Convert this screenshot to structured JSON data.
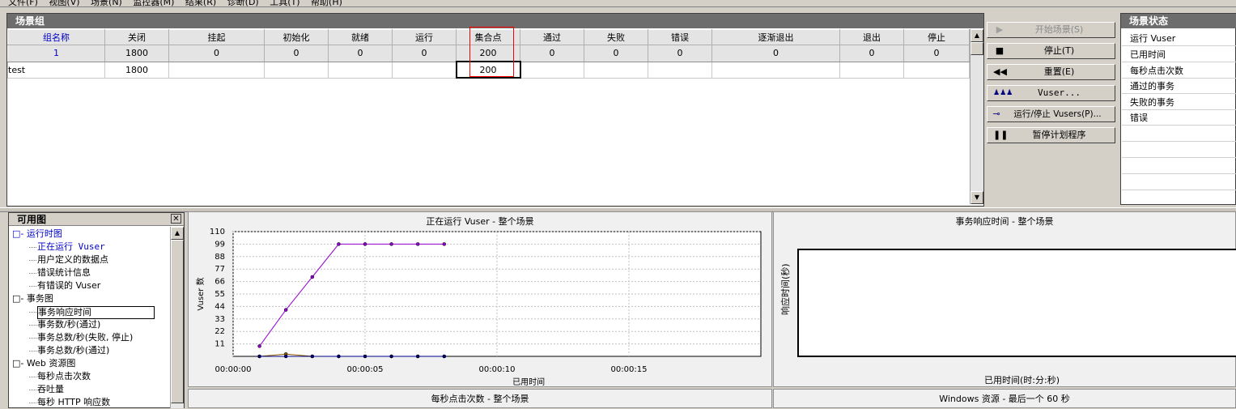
{
  "menu": [
    "文件(F)",
    "视图(V)",
    "场景(N)",
    "监控器(M)",
    "结果(R)",
    "诊断(D)",
    "工具(T)",
    "帮助(H)"
  ],
  "scenario_group": {
    "title": "场景组",
    "columns": [
      "组名称",
      "关闭",
      "挂起",
      "初始化",
      "就绪",
      "运行",
      "集合点",
      "通过",
      "失败",
      "错误",
      "逐渐退出",
      "退出",
      "停止"
    ],
    "totals": [
      "1",
      "1800",
      "0",
      "0",
      "0",
      "0",
      "200",
      "0",
      "0",
      "0",
      "0",
      "0",
      "0"
    ],
    "rows": [
      [
        "test",
        "1800",
        "",
        "",
        "",
        "",
        "200",
        "",
        "",
        "",
        "",
        "",
        ""
      ]
    ]
  },
  "controls": {
    "start": "开始场景(S)",
    "stop": "停止(T)",
    "reset": "重置(E)",
    "vuser": "Vuser...",
    "run_stop_vusers": "运行/停止 Vusers(P)...",
    "pause_schedule": "暂停计划程序"
  },
  "scenario_status": {
    "title": "场景状态",
    "rows": [
      "运行 Vuser",
      "已用时间",
      "每秒点击次数",
      "通过的事务",
      "失败的事务",
      "错误"
    ]
  },
  "available_graphs": {
    "title": "可用图",
    "items": [
      {
        "text": "□- 运行时图",
        "level": 0,
        "color": "#0000cc"
      },
      {
        "text": "正在运行 Vuser",
        "level": 1,
        "color": "#0000cc",
        "mono": true
      },
      {
        "text": "用户定义的数据点",
        "level": 1
      },
      {
        "text": "错误统计信息",
        "level": 1
      },
      {
        "text": "有错误的 Vuser",
        "level": 1
      },
      {
        "text": "□- 事务图",
        "level": 0
      },
      {
        "text": "事务响应时间",
        "level": 1,
        "selected": true
      },
      {
        "text": "事务数/秒(通过)",
        "level": 1
      },
      {
        "text": "事务总数/秒(失败, 停止)",
        "level": 1
      },
      {
        "text": "事务总数/秒(通过)",
        "level": 1
      },
      {
        "text": "□- Web 资源图",
        "level": 0
      },
      {
        "text": "每秒点击次数",
        "level": 1
      },
      {
        "text": "吞吐量",
        "level": 1
      },
      {
        "text": "每秒 HTTP 响应数",
        "level": 1
      }
    ]
  },
  "graphs": {
    "running_vusers": {
      "title": "正在运行 Vuser - 整个场景"
    },
    "transaction_response": {
      "title": "事务响应时间 - 整个场景",
      "ylabel": "响应时间(秒)",
      "xlabel": "已用时间(时:分:秒)"
    },
    "hits_per_second": {
      "title": "每秒点击次数 - 整个场景"
    },
    "windows_resources": {
      "title": "Windows 资源 - 最后一个 60 秒"
    }
  },
  "chart_data": {
    "type": "line",
    "title": "正在运行 Vuser - 整个场景",
    "xlabel": "已用时间",
    "ylabel": "Vuser 数",
    "y_ticks": [
      "110",
      "99",
      "88",
      "77",
      "66",
      "55",
      "44",
      "33",
      "22",
      "11"
    ],
    "x_ticks": [
      "00:00:00",
      "00:00:05",
      "00:00:10",
      "00:00:15"
    ],
    "ylim": [
      0,
      110
    ],
    "xlim": [
      0,
      20
    ],
    "grid": true,
    "series": [
      {
        "color": "#9400d3",
        "x": [
          1,
          2,
          3,
          4,
          5,
          6,
          7,
          8
        ],
        "values": [
          9,
          41,
          70,
          99,
          99,
          99,
          99,
          99
        ]
      },
      {
        "color": "#8b5a00",
        "x": [
          1,
          2,
          3,
          4,
          5,
          6,
          7,
          8
        ],
        "values": [
          0,
          2,
          0,
          0,
          0,
          0,
          0,
          0
        ]
      },
      {
        "color": "#000080",
        "x": [
          1,
          2,
          3,
          4,
          5,
          6,
          7,
          8
        ],
        "values": [
          0,
          0,
          0,
          0,
          0,
          0,
          0,
          0
        ]
      }
    ]
  }
}
